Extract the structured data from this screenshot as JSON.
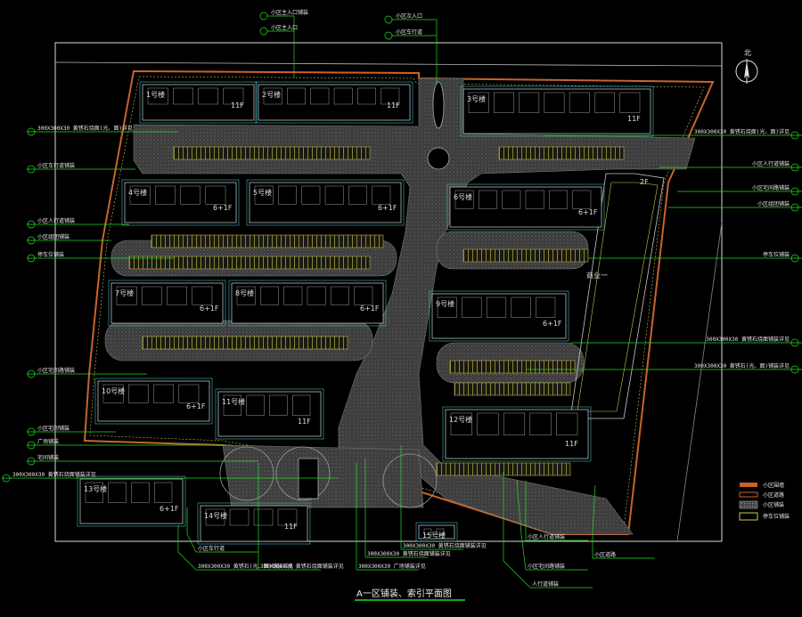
{
  "title": "A一区铺装、索引平面图",
  "north_label": "北",
  "colors": {
    "background": "#000000",
    "leader": "#22dd22",
    "road": "#3a3a3a",
    "frame": "#d8d8d8",
    "boundary_orange": "#c8642a",
    "yellow": "#c8c84a",
    "cyan": "#3fb6c0"
  },
  "buildings": [
    {
      "id": "b1",
      "name": "1号楼",
      "floors": "11F"
    },
    {
      "id": "b2",
      "name": "2号楼",
      "floors": "11F"
    },
    {
      "id": "b3",
      "name": "3号楼",
      "floors": "11F"
    },
    {
      "id": "b4",
      "name": "4号楼",
      "floors": "6+1F"
    },
    {
      "id": "b5",
      "name": "5号楼",
      "floors": "6+1F"
    },
    {
      "id": "b6",
      "name": "6号楼",
      "floors": "6+1F"
    },
    {
      "id": "b7",
      "name": "7号楼",
      "floors": "6+1F"
    },
    {
      "id": "b8",
      "name": "8号楼",
      "floors": "6+1F"
    },
    {
      "id": "b9",
      "name": "9号楼",
      "floors": "6+1F"
    },
    {
      "id": "b10",
      "name": "10号楼",
      "floors": "6+1F"
    },
    {
      "id": "b11",
      "name": "11号楼",
      "floors": "11F"
    },
    {
      "id": "b12",
      "name": "12号楼",
      "floors": "11F"
    },
    {
      "id": "b13",
      "name": "13号楼",
      "floors": "6+1F"
    },
    {
      "id": "b14",
      "name": "14号楼",
      "floors": "11F"
    },
    {
      "id": "b15",
      "name": "15号楼",
      "floors": ""
    }
  ],
  "annotations": {
    "clubhouse": "商业一",
    "clubhouse_floors": "2F",
    "top_left_1": "小区主入口铺装",
    "top_left_2": "小区主入口",
    "top_center_1": "小区次入口",
    "top_center_2": "小区车行道",
    "left_1": "300X300X30 黄锈石烧面(光、面)详见",
    "left_2": "小区车行道铺装",
    "left_3": "小区人行道铺装",
    "left_4": "小区组团铺装",
    "left_5": "停车位铺装",
    "left_6": "小区宅间路铺装",
    "left_7": "小区宅间铺装",
    "left_8": "广场铺装",
    "left_9": "宅间铺装",
    "left_10": "300X300X30 黄锈石烧面铺装详见",
    "right_1": "300X300X30 黄锈石烧面(光、面)详见",
    "right_2": "小区人行道铺装",
    "right_3": "小区宅间路铺装",
    "right_4": "小区组团铺装",
    "right_5": "停车位铺装",
    "right_6": "300X300X30 黄锈石烧面铺装详见",
    "right_7": "300X300X30 黄锈石(光、面)铺装详见",
    "bottom_1": "300X300X30 黄锈石烧面铺装详见",
    "bottom_2": "300X300X30 黄锈石烧面铺装详见",
    "bottom_3": "300X300X30 广场铺装详见",
    "bottom_4": "300X300X30 黄锈石烧面铺装详见",
    "bottom_5": "小区人行道铺装",
    "bottom_6": "小区宅间路铺装",
    "bottom_7": "人行道铺装",
    "bottom_8": "小区车行道",
    "bottom_9": "300X300X30 黄锈石(光、面)铺装详见",
    "bottom_10": "小区道路"
  },
  "legend": [
    {
      "label": "小区围墙",
      "swatch": "orange"
    },
    {
      "label": "小区道路",
      "swatch": "orange2"
    },
    {
      "label": "小区铺装",
      "swatch": "gray"
    },
    {
      "label": "停车位铺装",
      "swatch": "yellow"
    }
  ]
}
